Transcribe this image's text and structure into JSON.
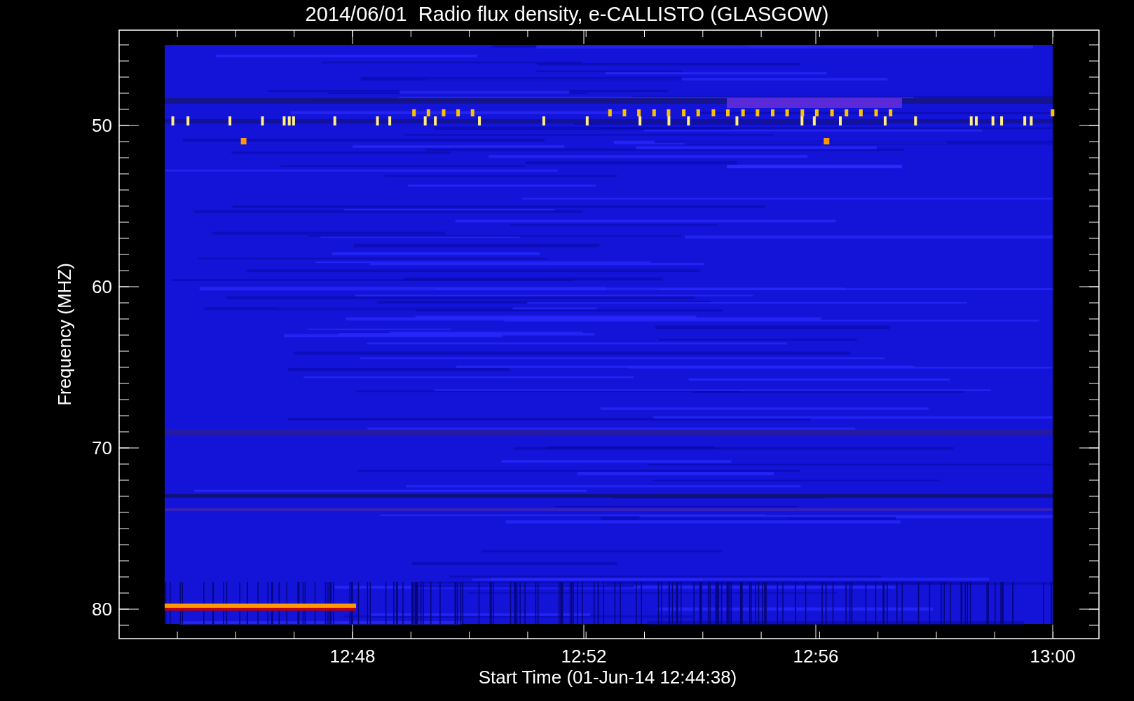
{
  "title": "2014/06/01  Radio flux density, e-CALLISTO (GLASGOW)",
  "y_axis": {
    "label": "Frequency (MHZ)",
    "ticks": [
      "50",
      "60",
      "70",
      "80"
    ]
  },
  "x_axis": {
    "label": "Start Time (01-Jun-14 12:44:38)",
    "ticks": [
      "12:48",
      "12:52",
      "12:56",
      "13:00"
    ]
  }
}
